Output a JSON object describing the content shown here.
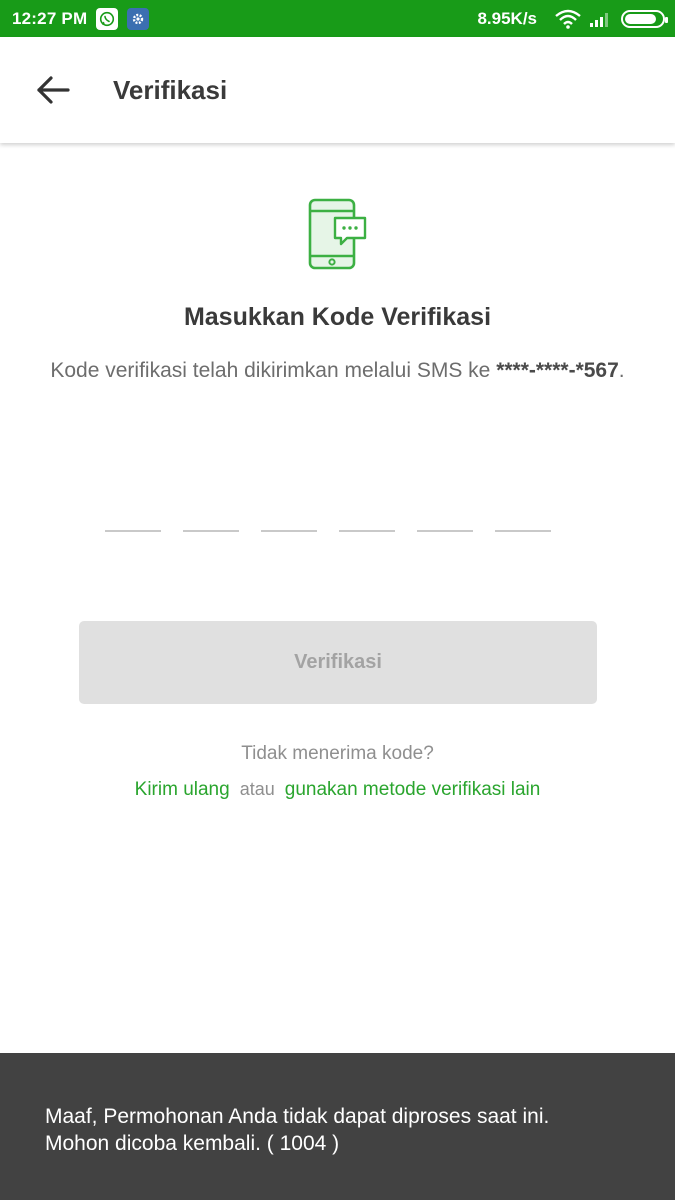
{
  "status_bar": {
    "time": "12:27 PM",
    "net_speed": "8.95K/s",
    "battery_level": 0.85,
    "icons": [
      "whatsapp-icon",
      "settings-app-icon",
      "wifi-icon",
      "signal-icon",
      "battery-icon"
    ]
  },
  "app_bar": {
    "title": "Verifikasi"
  },
  "main": {
    "heading": "Masukkan Kode Verifikasi",
    "desc_prefix": "Kode verifikasi telah dikirimkan melalui SMS ke ",
    "masked_phone": "****-****-*567",
    "desc_suffix": ".",
    "otp_length": 6,
    "verify_button": "Verifikasi",
    "no_code_text": "Tidak menerima kode?",
    "resend_link": "Kirim ulang",
    "or_text": "atau",
    "other_method_link": "gunakan metode verifikasi lain"
  },
  "snackbar": {
    "line1": "Maaf, Permohonan Anda tidak dapat diproses saat ini.",
    "line2": "Mohon dicoba kembali. ( 1004 )"
  },
  "colors": {
    "status_bar": "#189b18",
    "accent": "#2aa52e",
    "button_disabled": "#e0e0e0",
    "snackbar": "#424242"
  }
}
